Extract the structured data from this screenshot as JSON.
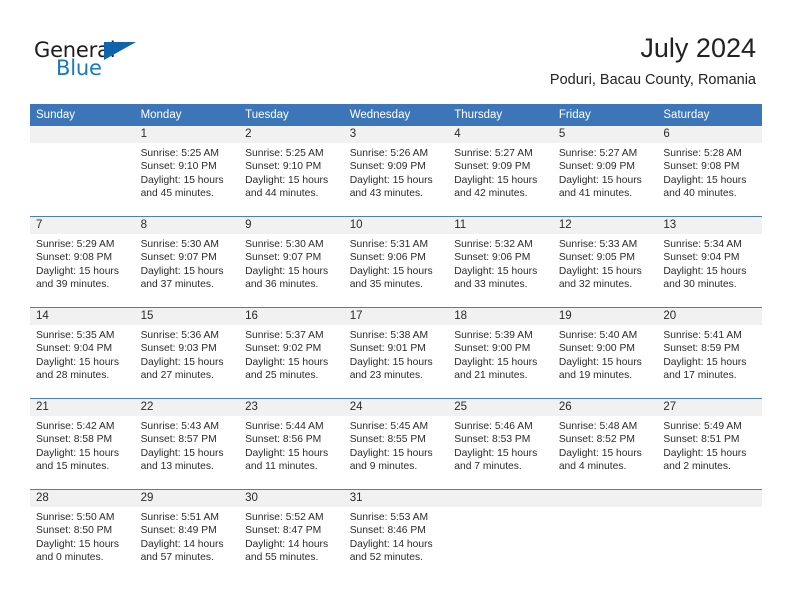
{
  "logo": {
    "primary_text": "General",
    "secondary_text": "Blue",
    "primary_color": "#1d1d1d",
    "secondary_color": "#1878c4",
    "triangle_color": "#1063ad"
  },
  "header": {
    "title": "July 2024",
    "location": "Poduri, Bacau County, Romania"
  },
  "theme": {
    "header_row_bg": "#3d76b8",
    "header_row_text": "#ffffff",
    "daynum_band_bg": "#f1f1f1",
    "week_divider": "#4a7fbd",
    "body_text": "#2b2b2b"
  },
  "weekday_headers": [
    "Sunday",
    "Monday",
    "Tuesday",
    "Wednesday",
    "Thursday",
    "Friday",
    "Saturday"
  ],
  "weeks": [
    [
      {
        "day": "",
        "sunrise": "",
        "sunset": "",
        "daylight_line1": "",
        "daylight_line2": ""
      },
      {
        "day": "1",
        "sunrise": "Sunrise: 5:25 AM",
        "sunset": "Sunset: 9:10 PM",
        "daylight_line1": "Daylight: 15 hours",
        "daylight_line2": "and 45 minutes."
      },
      {
        "day": "2",
        "sunrise": "Sunrise: 5:25 AM",
        "sunset": "Sunset: 9:10 PM",
        "daylight_line1": "Daylight: 15 hours",
        "daylight_line2": "and 44 minutes."
      },
      {
        "day": "3",
        "sunrise": "Sunrise: 5:26 AM",
        "sunset": "Sunset: 9:09 PM",
        "daylight_line1": "Daylight: 15 hours",
        "daylight_line2": "and 43 minutes."
      },
      {
        "day": "4",
        "sunrise": "Sunrise: 5:27 AM",
        "sunset": "Sunset: 9:09 PM",
        "daylight_line1": "Daylight: 15 hours",
        "daylight_line2": "and 42 minutes."
      },
      {
        "day": "5",
        "sunrise": "Sunrise: 5:27 AM",
        "sunset": "Sunset: 9:09 PM",
        "daylight_line1": "Daylight: 15 hours",
        "daylight_line2": "and 41 minutes."
      },
      {
        "day": "6",
        "sunrise": "Sunrise: 5:28 AM",
        "sunset": "Sunset: 9:08 PM",
        "daylight_line1": "Daylight: 15 hours",
        "daylight_line2": "and 40 minutes."
      }
    ],
    [
      {
        "day": "7",
        "sunrise": "Sunrise: 5:29 AM",
        "sunset": "Sunset: 9:08 PM",
        "daylight_line1": "Daylight: 15 hours",
        "daylight_line2": "and 39 minutes."
      },
      {
        "day": "8",
        "sunrise": "Sunrise: 5:30 AM",
        "sunset": "Sunset: 9:07 PM",
        "daylight_line1": "Daylight: 15 hours",
        "daylight_line2": "and 37 minutes."
      },
      {
        "day": "9",
        "sunrise": "Sunrise: 5:30 AM",
        "sunset": "Sunset: 9:07 PM",
        "daylight_line1": "Daylight: 15 hours",
        "daylight_line2": "and 36 minutes."
      },
      {
        "day": "10",
        "sunrise": "Sunrise: 5:31 AM",
        "sunset": "Sunset: 9:06 PM",
        "daylight_line1": "Daylight: 15 hours",
        "daylight_line2": "and 35 minutes."
      },
      {
        "day": "11",
        "sunrise": "Sunrise: 5:32 AM",
        "sunset": "Sunset: 9:06 PM",
        "daylight_line1": "Daylight: 15 hours",
        "daylight_line2": "and 33 minutes."
      },
      {
        "day": "12",
        "sunrise": "Sunrise: 5:33 AM",
        "sunset": "Sunset: 9:05 PM",
        "daylight_line1": "Daylight: 15 hours",
        "daylight_line2": "and 32 minutes."
      },
      {
        "day": "13",
        "sunrise": "Sunrise: 5:34 AM",
        "sunset": "Sunset: 9:04 PM",
        "daylight_line1": "Daylight: 15 hours",
        "daylight_line2": "and 30 minutes."
      }
    ],
    [
      {
        "day": "14",
        "sunrise": "Sunrise: 5:35 AM",
        "sunset": "Sunset: 9:04 PM",
        "daylight_line1": "Daylight: 15 hours",
        "daylight_line2": "and 28 minutes."
      },
      {
        "day": "15",
        "sunrise": "Sunrise: 5:36 AM",
        "sunset": "Sunset: 9:03 PM",
        "daylight_line1": "Daylight: 15 hours",
        "daylight_line2": "and 27 minutes."
      },
      {
        "day": "16",
        "sunrise": "Sunrise: 5:37 AM",
        "sunset": "Sunset: 9:02 PM",
        "daylight_line1": "Daylight: 15 hours",
        "daylight_line2": "and 25 minutes."
      },
      {
        "day": "17",
        "sunrise": "Sunrise: 5:38 AM",
        "sunset": "Sunset: 9:01 PM",
        "daylight_line1": "Daylight: 15 hours",
        "daylight_line2": "and 23 minutes."
      },
      {
        "day": "18",
        "sunrise": "Sunrise: 5:39 AM",
        "sunset": "Sunset: 9:00 PM",
        "daylight_line1": "Daylight: 15 hours",
        "daylight_line2": "and 21 minutes."
      },
      {
        "day": "19",
        "sunrise": "Sunrise: 5:40 AM",
        "sunset": "Sunset: 9:00 PM",
        "daylight_line1": "Daylight: 15 hours",
        "daylight_line2": "and 19 minutes."
      },
      {
        "day": "20",
        "sunrise": "Sunrise: 5:41 AM",
        "sunset": "Sunset: 8:59 PM",
        "daylight_line1": "Daylight: 15 hours",
        "daylight_line2": "and 17 minutes."
      }
    ],
    [
      {
        "day": "21",
        "sunrise": "Sunrise: 5:42 AM",
        "sunset": "Sunset: 8:58 PM",
        "daylight_line1": "Daylight: 15 hours",
        "daylight_line2": "and 15 minutes."
      },
      {
        "day": "22",
        "sunrise": "Sunrise: 5:43 AM",
        "sunset": "Sunset: 8:57 PM",
        "daylight_line1": "Daylight: 15 hours",
        "daylight_line2": "and 13 minutes."
      },
      {
        "day": "23",
        "sunrise": "Sunrise: 5:44 AM",
        "sunset": "Sunset: 8:56 PM",
        "daylight_line1": "Daylight: 15 hours",
        "daylight_line2": "and 11 minutes."
      },
      {
        "day": "24",
        "sunrise": "Sunrise: 5:45 AM",
        "sunset": "Sunset: 8:55 PM",
        "daylight_line1": "Daylight: 15 hours",
        "daylight_line2": "and 9 minutes."
      },
      {
        "day": "25",
        "sunrise": "Sunrise: 5:46 AM",
        "sunset": "Sunset: 8:53 PM",
        "daylight_line1": "Daylight: 15 hours",
        "daylight_line2": "and 7 minutes."
      },
      {
        "day": "26",
        "sunrise": "Sunrise: 5:48 AM",
        "sunset": "Sunset: 8:52 PM",
        "daylight_line1": "Daylight: 15 hours",
        "daylight_line2": "and 4 minutes."
      },
      {
        "day": "27",
        "sunrise": "Sunrise: 5:49 AM",
        "sunset": "Sunset: 8:51 PM",
        "daylight_line1": "Daylight: 15 hours",
        "daylight_line2": "and 2 minutes."
      }
    ],
    [
      {
        "day": "28",
        "sunrise": "Sunrise: 5:50 AM",
        "sunset": "Sunset: 8:50 PM",
        "daylight_line1": "Daylight: 15 hours",
        "daylight_line2": "and 0 minutes."
      },
      {
        "day": "29",
        "sunrise": "Sunrise: 5:51 AM",
        "sunset": "Sunset: 8:49 PM",
        "daylight_line1": "Daylight: 14 hours",
        "daylight_line2": "and 57 minutes."
      },
      {
        "day": "30",
        "sunrise": "Sunrise: 5:52 AM",
        "sunset": "Sunset: 8:47 PM",
        "daylight_line1": "Daylight: 14 hours",
        "daylight_line2": "and 55 minutes."
      },
      {
        "day": "31",
        "sunrise": "Sunrise: 5:53 AM",
        "sunset": "Sunset: 8:46 PM",
        "daylight_line1": "Daylight: 14 hours",
        "daylight_line2": "and 52 minutes."
      },
      {
        "day": "",
        "sunrise": "",
        "sunset": "",
        "daylight_line1": "",
        "daylight_line2": ""
      },
      {
        "day": "",
        "sunrise": "",
        "sunset": "",
        "daylight_line1": "",
        "daylight_line2": ""
      },
      {
        "day": "",
        "sunrise": "",
        "sunset": "",
        "daylight_line1": "",
        "daylight_line2": ""
      }
    ]
  ]
}
